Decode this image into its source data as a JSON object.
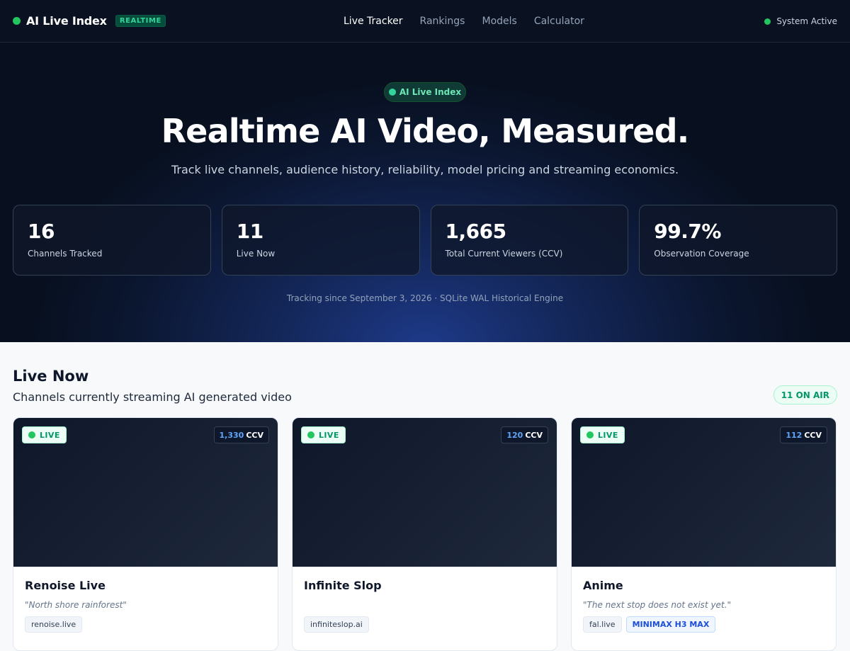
{
  "nav": {
    "brand": "AI Live Index",
    "badge": "REALTIME",
    "links": [
      "Live Tracker",
      "Rankings",
      "Models",
      "Calculator"
    ],
    "status": "System Active"
  },
  "hero": {
    "pill": "AI Live Index",
    "title": "Realtime AI Video, Measured.",
    "subtitle": "Track live channels, audience history, reliability, model pricing and streaming economics.",
    "stats": [
      {
        "value": "16",
        "label": "Channels Tracked"
      },
      {
        "value": "11",
        "label": "Live Now"
      },
      {
        "value": "1,665",
        "label": "Total Current Viewers (CCV)"
      },
      {
        "value": "99.7%",
        "label": "Observation Coverage"
      }
    ],
    "footnote": "Tracking since September 3, 2026 · SQLite WAL Historical Engine"
  },
  "live": {
    "title": "Live Now",
    "subtitle": "Channels currently streaming AI generated video",
    "on_air": "11 ON AIR",
    "live_label": "LIVE",
    "ccv_unit": "CCV",
    "cards": [
      {
        "name": "Renoise Live",
        "ccv": "1,330",
        "quote": "\"North shore rainforest\"",
        "tags": [
          "renoise.live"
        ],
        "model": ""
      },
      {
        "name": "Infinite Slop",
        "ccv": "120",
        "quote": "",
        "tags": [
          "infiniteslop.ai"
        ],
        "model": ""
      },
      {
        "name": "Anime",
        "ccv": "112",
        "quote": "\"The next stop does not exist yet.\"",
        "tags": [
          "fal.live"
        ],
        "model": "MINIMAX H3 MAX"
      }
    ]
  },
  "colors": {
    "accent": "#22c55e",
    "ccv": "#60a5fa",
    "hero_bg": "#0b1630"
  }
}
